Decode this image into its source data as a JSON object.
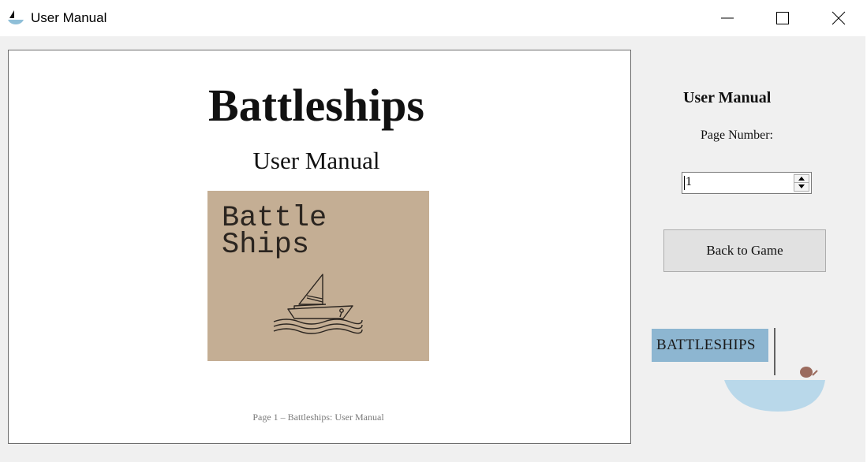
{
  "window": {
    "title": "User Manual",
    "icon": "sailboat-icon",
    "controls": [
      "minimize-icon",
      "maximize-icon",
      "close-icon"
    ]
  },
  "document": {
    "title": "Battleships",
    "subtitle": "User Manual",
    "cover_image": {
      "text_line1": "Battle",
      "text_line2": "Ships",
      "icon": "sailboat-on-waves-icon",
      "background_color": "#c4ae94"
    },
    "footer": "Page 1 – Battleships: User Manual"
  },
  "sidebar": {
    "heading": "User Manual",
    "page_number_label": "Page Number:",
    "page_number_value": "1",
    "back_button_label": "Back to Game"
  },
  "logo": {
    "text": "BATTLESHIPS",
    "plate_color": "#8db6d1",
    "hull_color": "#b9d8ea"
  }
}
